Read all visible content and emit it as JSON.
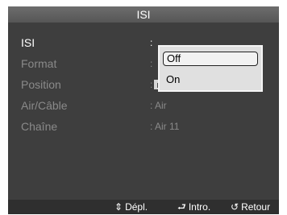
{
  "menu": {
    "title": "ISI",
    "items": [
      {
        "label": "ISI",
        "value": ":"
      },
      {
        "label": "Format",
        "value": ":"
      },
      {
        "label": "Position",
        "value": ":"
      },
      {
        "label": "Air/Câble",
        "value": ": Air"
      },
      {
        "label": "Chaîne",
        "value": ": Air 11"
      }
    ]
  },
  "dropdown": {
    "options": [
      "Off",
      "On"
    ],
    "selected": "Off"
  },
  "footer": {
    "move": {
      "icon": "up-down-arrows-icon",
      "glyph": "⇕",
      "label": "Dépl."
    },
    "enter": {
      "icon": "enter-icon",
      "glyph": "⮐",
      "label": "Intro."
    },
    "return": {
      "icon": "return-icon",
      "glyph": "↺",
      "label": "Retour"
    }
  }
}
